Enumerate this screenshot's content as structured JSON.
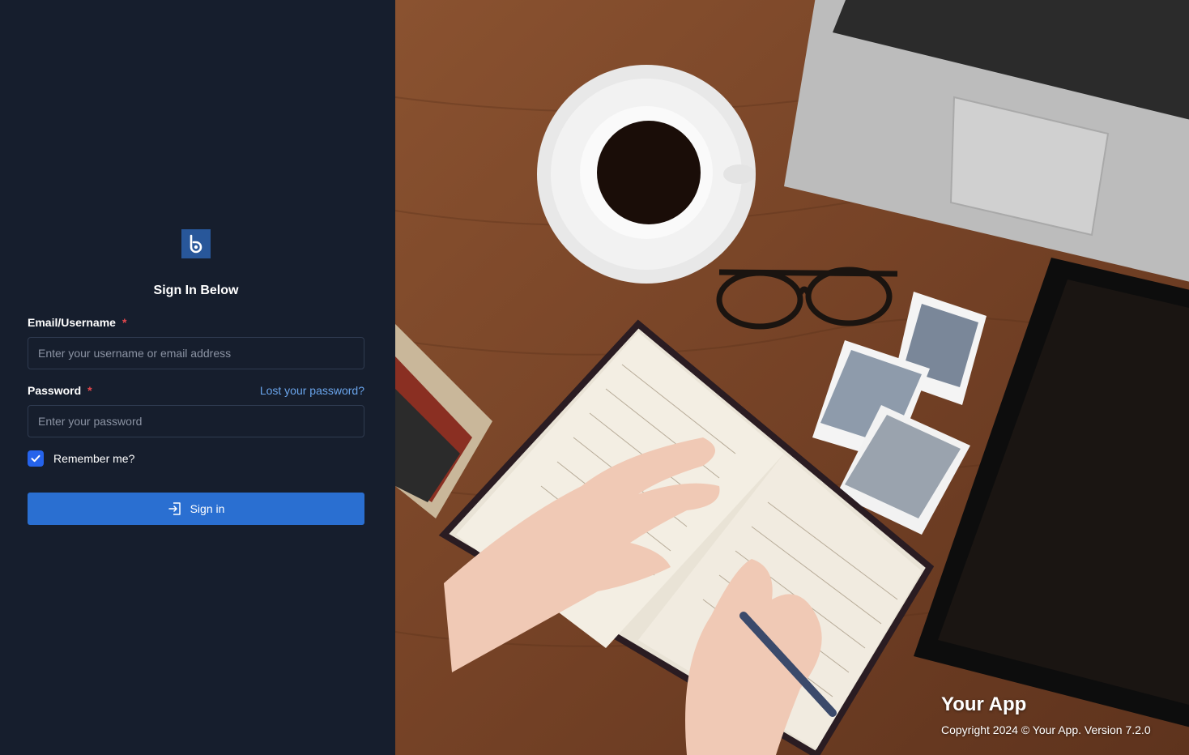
{
  "brand": {
    "logo_icon": "logo-b-icon",
    "accent": "#2a6fd1",
    "panel_bg": "#161e2d"
  },
  "form": {
    "heading": "Sign In Below",
    "email_label": "Email/Username",
    "email_placeholder": "Enter your username or email address",
    "password_label": "Password",
    "password_placeholder": "Enter your password",
    "required_mark": "*",
    "lost_password": "Lost your password?",
    "remember_label": "Remember me?",
    "remember_checked": true,
    "signin_label": "Sign in",
    "signin_icon": "sign-in-icon"
  },
  "footer": {
    "app_name": "Your App",
    "copyright": "Copyright 2024 © Your App. Version 7.2.0"
  }
}
